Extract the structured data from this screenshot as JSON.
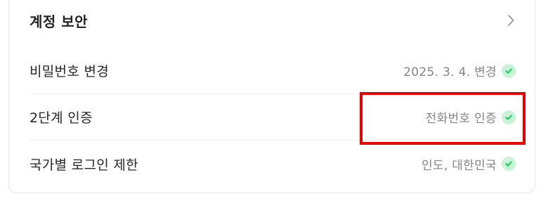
{
  "section": {
    "title": "계정 보안",
    "chevron_icon": "chevron-right-icon"
  },
  "rows": [
    {
      "label": "비밀번호 변경",
      "status": "2025. 3. 4. 변경",
      "status_icon": "check-circle-icon"
    },
    {
      "label": "2단계 인증",
      "status": "전화번호 인증",
      "status_icon": "check-circle-icon"
    },
    {
      "label": "국가별 로그인 제한",
      "status": "인도, 대한민국",
      "status_icon": "check-circle-icon"
    }
  ],
  "colors": {
    "check_bg": "#c9f3d6",
    "check_mark": "#1ec15f",
    "highlight": "#e80000"
  }
}
